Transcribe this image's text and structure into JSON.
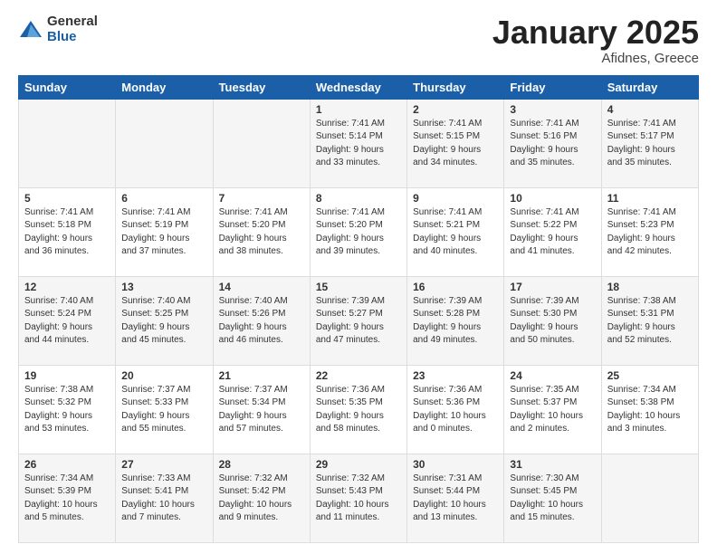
{
  "header": {
    "logo_general": "General",
    "logo_blue": "Blue",
    "title": "January 2025",
    "location": "Afidnes, Greece"
  },
  "weekdays": [
    "Sunday",
    "Monday",
    "Tuesday",
    "Wednesday",
    "Thursday",
    "Friday",
    "Saturday"
  ],
  "weeks": [
    [
      {
        "day": "",
        "info": ""
      },
      {
        "day": "",
        "info": ""
      },
      {
        "day": "",
        "info": ""
      },
      {
        "day": "1",
        "info": "Sunrise: 7:41 AM\nSunset: 5:14 PM\nDaylight: 9 hours\nand 33 minutes."
      },
      {
        "day": "2",
        "info": "Sunrise: 7:41 AM\nSunset: 5:15 PM\nDaylight: 9 hours\nand 34 minutes."
      },
      {
        "day": "3",
        "info": "Sunrise: 7:41 AM\nSunset: 5:16 PM\nDaylight: 9 hours\nand 35 minutes."
      },
      {
        "day": "4",
        "info": "Sunrise: 7:41 AM\nSunset: 5:17 PM\nDaylight: 9 hours\nand 35 minutes."
      }
    ],
    [
      {
        "day": "5",
        "info": "Sunrise: 7:41 AM\nSunset: 5:18 PM\nDaylight: 9 hours\nand 36 minutes."
      },
      {
        "day": "6",
        "info": "Sunrise: 7:41 AM\nSunset: 5:19 PM\nDaylight: 9 hours\nand 37 minutes."
      },
      {
        "day": "7",
        "info": "Sunrise: 7:41 AM\nSunset: 5:20 PM\nDaylight: 9 hours\nand 38 minutes."
      },
      {
        "day": "8",
        "info": "Sunrise: 7:41 AM\nSunset: 5:20 PM\nDaylight: 9 hours\nand 39 minutes."
      },
      {
        "day": "9",
        "info": "Sunrise: 7:41 AM\nSunset: 5:21 PM\nDaylight: 9 hours\nand 40 minutes."
      },
      {
        "day": "10",
        "info": "Sunrise: 7:41 AM\nSunset: 5:22 PM\nDaylight: 9 hours\nand 41 minutes."
      },
      {
        "day": "11",
        "info": "Sunrise: 7:41 AM\nSunset: 5:23 PM\nDaylight: 9 hours\nand 42 minutes."
      }
    ],
    [
      {
        "day": "12",
        "info": "Sunrise: 7:40 AM\nSunset: 5:24 PM\nDaylight: 9 hours\nand 44 minutes."
      },
      {
        "day": "13",
        "info": "Sunrise: 7:40 AM\nSunset: 5:25 PM\nDaylight: 9 hours\nand 45 minutes."
      },
      {
        "day": "14",
        "info": "Sunrise: 7:40 AM\nSunset: 5:26 PM\nDaylight: 9 hours\nand 46 minutes."
      },
      {
        "day": "15",
        "info": "Sunrise: 7:39 AM\nSunset: 5:27 PM\nDaylight: 9 hours\nand 47 minutes."
      },
      {
        "day": "16",
        "info": "Sunrise: 7:39 AM\nSunset: 5:28 PM\nDaylight: 9 hours\nand 49 minutes."
      },
      {
        "day": "17",
        "info": "Sunrise: 7:39 AM\nSunset: 5:30 PM\nDaylight: 9 hours\nand 50 minutes."
      },
      {
        "day": "18",
        "info": "Sunrise: 7:38 AM\nSunset: 5:31 PM\nDaylight: 9 hours\nand 52 minutes."
      }
    ],
    [
      {
        "day": "19",
        "info": "Sunrise: 7:38 AM\nSunset: 5:32 PM\nDaylight: 9 hours\nand 53 minutes."
      },
      {
        "day": "20",
        "info": "Sunrise: 7:37 AM\nSunset: 5:33 PM\nDaylight: 9 hours\nand 55 minutes."
      },
      {
        "day": "21",
        "info": "Sunrise: 7:37 AM\nSunset: 5:34 PM\nDaylight: 9 hours\nand 57 minutes."
      },
      {
        "day": "22",
        "info": "Sunrise: 7:36 AM\nSunset: 5:35 PM\nDaylight: 9 hours\nand 58 minutes."
      },
      {
        "day": "23",
        "info": "Sunrise: 7:36 AM\nSunset: 5:36 PM\nDaylight: 10 hours\nand 0 minutes."
      },
      {
        "day": "24",
        "info": "Sunrise: 7:35 AM\nSunset: 5:37 PM\nDaylight: 10 hours\nand 2 minutes."
      },
      {
        "day": "25",
        "info": "Sunrise: 7:34 AM\nSunset: 5:38 PM\nDaylight: 10 hours\nand 3 minutes."
      }
    ],
    [
      {
        "day": "26",
        "info": "Sunrise: 7:34 AM\nSunset: 5:39 PM\nDaylight: 10 hours\nand 5 minutes."
      },
      {
        "day": "27",
        "info": "Sunrise: 7:33 AM\nSunset: 5:41 PM\nDaylight: 10 hours\nand 7 minutes."
      },
      {
        "day": "28",
        "info": "Sunrise: 7:32 AM\nSunset: 5:42 PM\nDaylight: 10 hours\nand 9 minutes."
      },
      {
        "day": "29",
        "info": "Sunrise: 7:32 AM\nSunset: 5:43 PM\nDaylight: 10 hours\nand 11 minutes."
      },
      {
        "day": "30",
        "info": "Sunrise: 7:31 AM\nSunset: 5:44 PM\nDaylight: 10 hours\nand 13 minutes."
      },
      {
        "day": "31",
        "info": "Sunrise: 7:30 AM\nSunset: 5:45 PM\nDaylight: 10 hours\nand 15 minutes."
      },
      {
        "day": "",
        "info": ""
      }
    ]
  ]
}
